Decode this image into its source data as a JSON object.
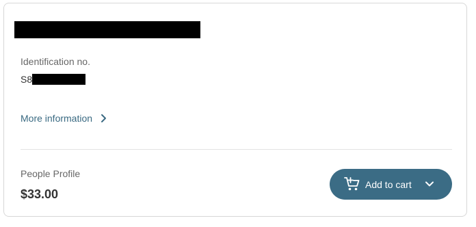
{
  "product": {
    "id_label": "Identification no.",
    "id_prefix": "S8",
    "more_info_label": "More information",
    "profile_label": "People Profile",
    "price": "$33.00"
  },
  "actions": {
    "add_to_cart_label": "Add to cart"
  },
  "icons": {
    "more_info": "chevron-right-icon",
    "cart": "add-to-cart-icon",
    "dropdown": "chevron-down-icon"
  },
  "colors": {
    "accent": "#3b6c85",
    "link": "#3a6a82",
    "border": "#d7d7d7"
  }
}
